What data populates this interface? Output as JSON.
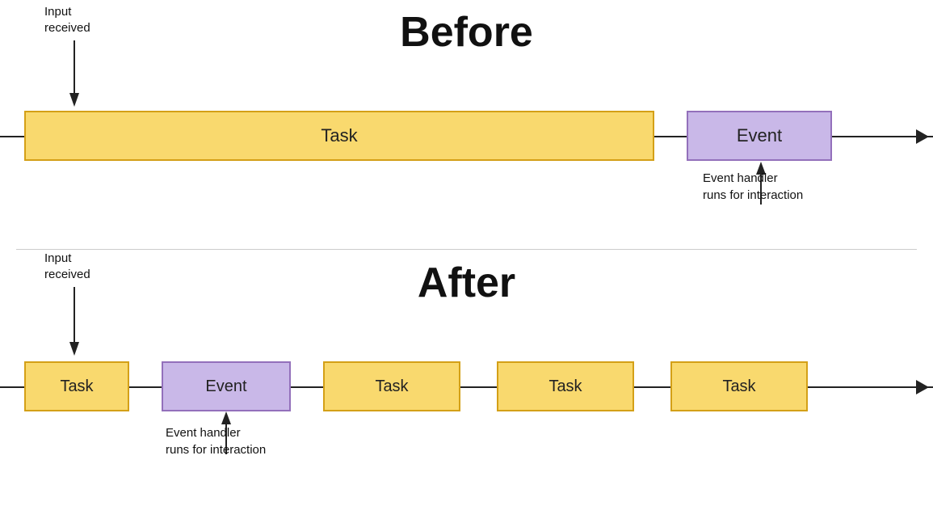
{
  "before": {
    "title": "Before",
    "input_received_label": "Input\nreceived",
    "task_label": "Task",
    "event_label": "Event",
    "event_handler_label": "Event handler\nruns for interaction"
  },
  "after": {
    "title": "After",
    "input_received_label": "Input\nreceived",
    "task_label_1": "Task",
    "event_label": "Event",
    "task_label_2": "Task",
    "task_label_3": "Task",
    "task_label_4": "Task",
    "event_handler_label": "Event handler\nruns for interaction"
  }
}
